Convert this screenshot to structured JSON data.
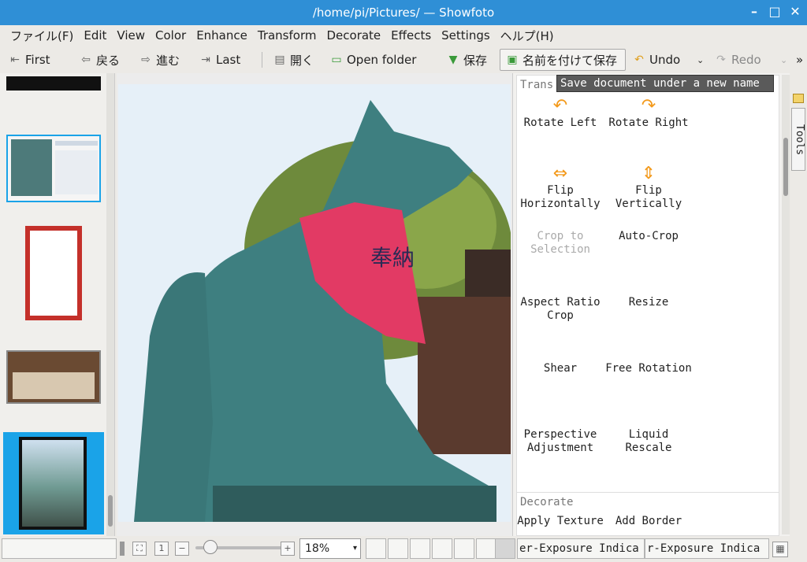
{
  "window": {
    "title": "/home/pi/Pictures/ — Showfoto"
  },
  "menubar": {
    "items": [
      "ファイル(F)",
      "Edit",
      "View",
      "Color",
      "Enhance",
      "Transform",
      "Decorate",
      "Effects",
      "Settings",
      "ヘルプ(H)"
    ]
  },
  "toolbar": {
    "first": "First",
    "back": "戻る",
    "forward": "進む",
    "last": "Last",
    "open": "開く",
    "open_folder": "Open folder",
    "save": "保存",
    "save_as": "名前を付けて保存",
    "undo": "Undo",
    "redo": "Redo",
    "overflow": "»"
  },
  "tooltip": {
    "text": "Save document under a new name"
  },
  "tools_panel": {
    "side_tab": "Tools",
    "transform_group": "Trans",
    "decorate_group": "Decorate",
    "transform_tools": [
      {
        "label": "Rotate Left",
        "icon": "rotate-left-icon"
      },
      {
        "label": "Rotate Right",
        "icon": "rotate-right-icon"
      },
      {
        "label": "Flip Horizontally",
        "icon": "flip-horizontal-icon"
      },
      {
        "label": "Flip Vertically",
        "icon": "flip-vertical-icon"
      },
      {
        "label": "Crop to Selection",
        "disabled": true
      },
      {
        "label": "Auto-Crop"
      },
      {
        "label": "Aspect Ratio Crop"
      },
      {
        "label": "Resize"
      },
      {
        "label": "Shear"
      },
      {
        "label": "Free Rotation"
      },
      {
        "label": "Perspective Adjustment"
      },
      {
        "label": "Liquid Rescale"
      }
    ],
    "decorate_tools": [
      {
        "label": "Apply Texture"
      },
      {
        "label": "Add Border"
      }
    ]
  },
  "photo": {
    "banner_text": "奉納"
  },
  "statusbar": {
    "zoom": "18%",
    "indicator_1": "er-Exposure Indica",
    "indicator_2": "r-Exposure Indica"
  },
  "colors": {
    "title_bar": "#2f8fd6",
    "selection": "#1aa3e8",
    "accent_arrow": "#f39a1c"
  }
}
